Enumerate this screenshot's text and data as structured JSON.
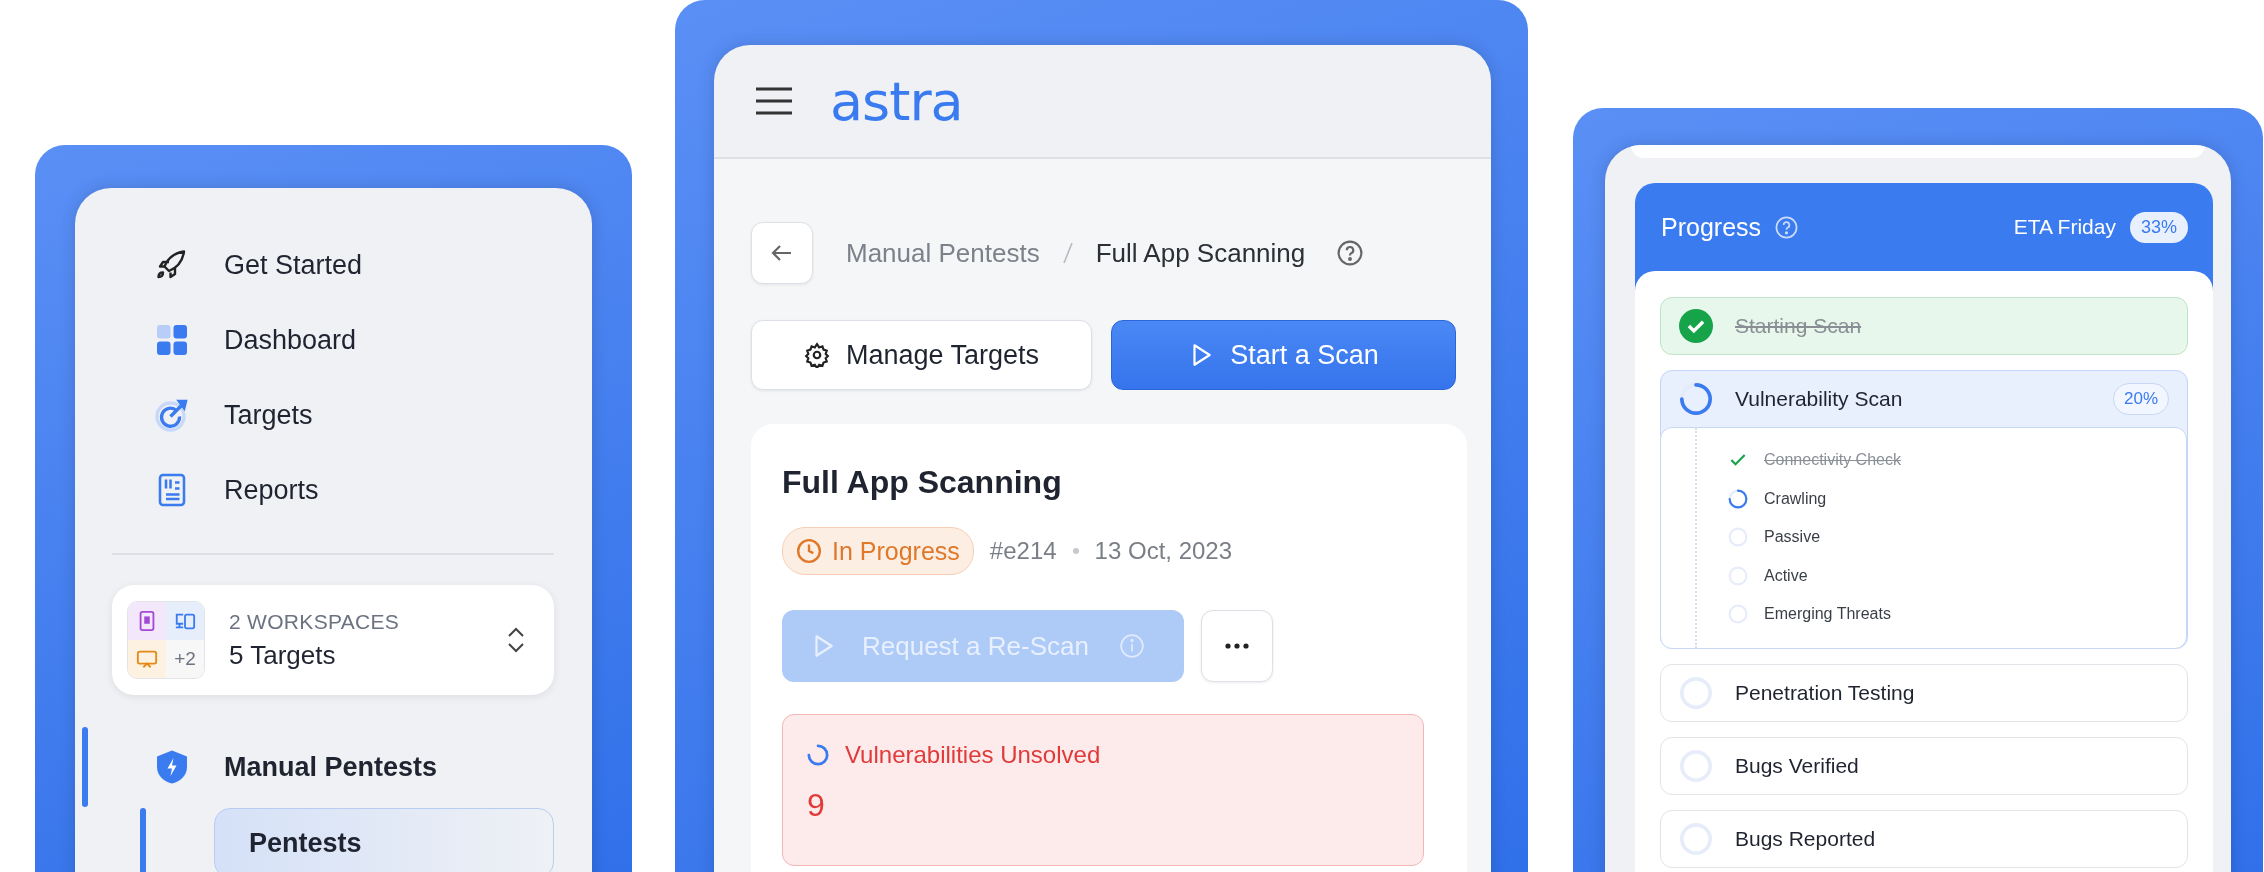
{
  "sidebar": {
    "items": [
      {
        "kind": "rocket",
        "label": "Get Started",
        "selected": false
      },
      {
        "kind": "grid",
        "label": "Dashboard",
        "selected": false
      },
      {
        "kind": "target",
        "label": "Targets",
        "selected": false
      },
      {
        "kind": "report",
        "label": "Reports",
        "selected": false
      }
    ],
    "workspace": {
      "extra": "+2",
      "title": "2 WORKSPACES",
      "targets": "5 Targets"
    },
    "section": {
      "kind": "shield",
      "label": "Manual Pentests",
      "selected": true,
      "expanded": true,
      "children": [
        {
          "label": "Pentests",
          "selected": true
        }
      ]
    }
  },
  "app": {
    "logo": "astra",
    "breadcrumb": {
      "parent": "Manual Pentests",
      "current": "Full App Scanning"
    },
    "buttons": [
      {
        "kind": "gear",
        "label": "Manage Targets",
        "primary": false
      },
      {
        "kind": "play",
        "label": "Start a Scan",
        "primary": true
      }
    ],
    "scan": {
      "title": "Full App Scanning",
      "status": "In Progress",
      "id": "#e214",
      "date": "13 Oct, 2023",
      "rescan": {
        "label": "Request a Re-Scan",
        "disabled": true
      },
      "alert": {
        "label": "Vulnerabilities Unsolved",
        "count": "9"
      }
    }
  },
  "progress": {
    "title": "Progress",
    "eta": "ETA Friday",
    "percent": "33%",
    "steps": [
      {
        "label": "Starting Scan",
        "kind": "done"
      },
      {
        "label": "Vulnerability Scan",
        "kind": "running",
        "percent": "20%",
        "expanded": true,
        "children": [
          {
            "label": "Connectivity Check",
            "kind": "done"
          },
          {
            "label": "Crawling",
            "kind": "running"
          },
          {
            "label": "Passive",
            "kind": "pending"
          },
          {
            "label": "Active",
            "kind": "pending"
          },
          {
            "label": "Emerging Threats",
            "kind": "pending"
          }
        ]
      },
      {
        "label": "Penetration Testing",
        "kind": "pending"
      },
      {
        "label": "Bugs Verified",
        "kind": "pending"
      },
      {
        "label": "Bugs Reported",
        "kind": "pending"
      }
    ]
  }
}
